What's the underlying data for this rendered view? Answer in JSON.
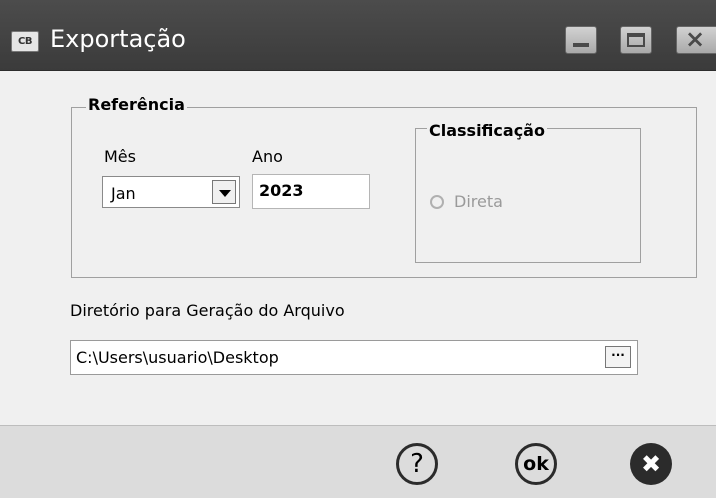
{
  "window": {
    "icon_text": "CB",
    "title": "Exportação"
  },
  "referencia": {
    "legend": "Referência",
    "mes_label": "Mês",
    "mes_value": "Jan",
    "ano_label": "Ano",
    "ano_value": "2023"
  },
  "classificacao": {
    "legend": "Classificação",
    "option_label": "Direta",
    "option_selected": false,
    "option_enabled": false
  },
  "diretorio": {
    "label": "Diretório para Geração do Arquivo",
    "value": "C:\\Users\\usuario\\Desktop",
    "browse_label": "···"
  },
  "footer": {
    "help_icon": "help-icon",
    "ok_icon": "ok-icon",
    "cancel_icon": "cancel-icon",
    "help_glyph": "?",
    "ok_glyph": "ok",
    "cancel_glyph": "✖"
  }
}
